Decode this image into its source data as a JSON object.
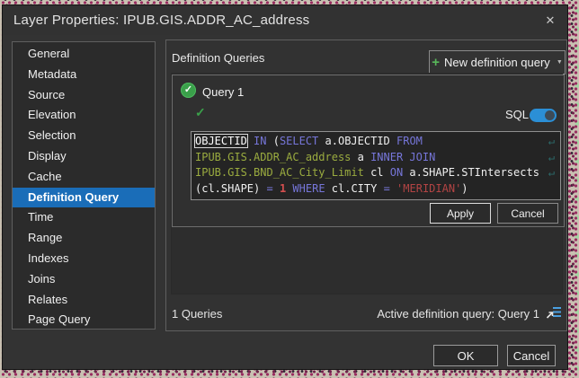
{
  "window": {
    "title": "Layer Properties: IPUB.GIS.ADDR_AC_address"
  },
  "icons": {
    "close_glyph": "✕",
    "check_glyph": "✓",
    "plus_glyph": "+",
    "caret_glyph": "▼",
    "wrap_glyph": "↵"
  },
  "sidebar": {
    "items": [
      {
        "label": "General"
      },
      {
        "label": "Metadata"
      },
      {
        "label": "Source"
      },
      {
        "label": "Elevation"
      },
      {
        "label": "Selection"
      },
      {
        "label": "Display"
      },
      {
        "label": "Cache"
      },
      {
        "label": "Definition Query",
        "selected": true
      },
      {
        "label": "Time"
      },
      {
        "label": "Range"
      },
      {
        "label": "Indexes"
      },
      {
        "label": "Joins"
      },
      {
        "label": "Relates"
      },
      {
        "label": "Page Query"
      }
    ]
  },
  "main": {
    "header": "Definition Queries",
    "new_query_button": {
      "label": "New definition query"
    },
    "query": {
      "title": "Query 1",
      "sql_label": "SQL",
      "sql_toggle_on": true,
      "apply_label": "Apply",
      "cancel_label": "Cancel",
      "sql_lines": [
        {
          "wrap": true,
          "tokens": [
            {
              "t": "OBJECTID",
              "c": "b"
            },
            {
              "t": " ",
              "c": "p"
            },
            {
              "t": "IN",
              "c": "k"
            },
            {
              "t": " (",
              "c": "p"
            },
            {
              "t": "SELECT",
              "c": "k"
            },
            {
              "t": " a.OBJECTID ",
              "c": "p"
            },
            {
              "t": "FROM",
              "c": "k"
            }
          ]
        },
        {
          "wrap": true,
          "tokens": [
            {
              "t": "IPUB.GIS.ADDR_AC_address",
              "c": "t"
            },
            {
              "t": " a ",
              "c": "p"
            },
            {
              "t": "INNER JOIN",
              "c": "k"
            }
          ]
        },
        {
          "wrap": true,
          "tokens": [
            {
              "t": "IPUB.GIS.BND_AC_City_Limit",
              "c": "t"
            },
            {
              "t": " cl ",
              "c": "p"
            },
            {
              "t": "ON",
              "c": "k"
            },
            {
              "t": " a.SHAPE.STIntersects",
              "c": "p"
            }
          ]
        },
        {
          "wrap": false,
          "tokens": [
            {
              "t": "(cl.SHAPE) ",
              "c": "p"
            },
            {
              "t": "=",
              "c": "k"
            },
            {
              "t": " ",
              "c": "p"
            },
            {
              "t": "1",
              "c": "n"
            },
            {
              "t": " ",
              "c": "p"
            },
            {
              "t": "WHERE",
              "c": "k"
            },
            {
              "t": " cl.CITY ",
              "c": "p"
            },
            {
              "t": "=",
              "c": "k"
            },
            {
              "t": " ",
              "c": "p"
            },
            {
              "t": "'MERIDIAN'",
              "c": "s"
            },
            {
              "t": ")",
              "c": "p"
            }
          ]
        }
      ]
    },
    "status_left": "1 Queries",
    "status_right": "Active definition query: Query 1"
  },
  "footer": {
    "ok_label": "OK",
    "cancel_label": "Cancel"
  },
  "colors": {
    "selection_blue": "#1a6db8",
    "toggle_blue": "#2b8fd6",
    "success_green": "#3aa04a",
    "sql_keyword": "#7676d9",
    "sql_table_name": "#9aab3f",
    "sql_number_literal": "#d54f4f",
    "sql_string_literal": "#b34444",
    "dialog_background": "#333333"
  }
}
